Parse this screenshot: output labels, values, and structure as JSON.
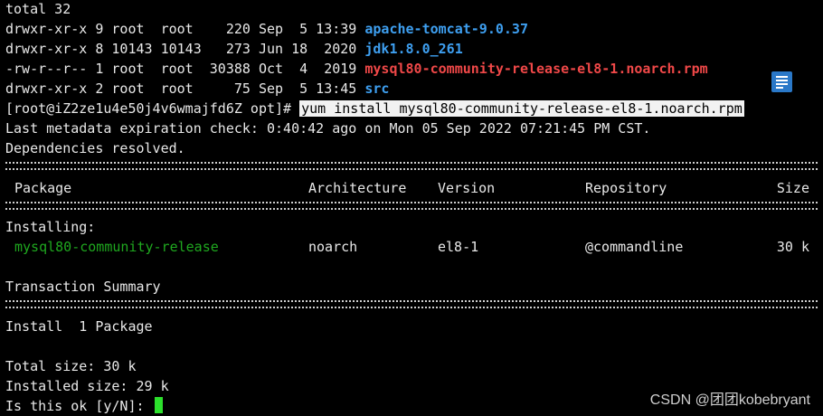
{
  "listing": {
    "total": "total 32",
    "entries": [
      {
        "meta": "drwxr-xr-x 9 root  root    220 Sep  5 13:39 ",
        "name": "apache-tomcat-9.0.37"
      },
      {
        "meta": "drwxr-xr-x 8 10143 10143   273 Jun 18  2020 ",
        "name": "jdk1.8.0_261"
      },
      {
        "meta": "-rw-r--r-- 1 root  root  30388 Oct  4  2019 ",
        "name": "mysql80-community-release-el8-1.noarch.rpm"
      },
      {
        "meta": "drwxr-xr-x 2 root  root     75 Sep  5 13:45 ",
        "name": "src"
      }
    ]
  },
  "prompt": {
    "text": "[root@iZ2ze1u4e50j4v6wmajfd6Z opt]# ",
    "command": "yum install mysql80-community-release-el8-1.noarch.rpm"
  },
  "output": {
    "metadata": "Last metadata expiration check: 0:40:42 ago on Mon 05 Sep 2022 07:21:45 PM CST.",
    "deps": "Dependencies resolved.",
    "headers": {
      "package": "Package",
      "arch": "Architecture",
      "version": "Version",
      "repo": "Repository",
      "size": "Size"
    },
    "installing": "Installing:",
    "pkg": {
      "name": "mysql80-community-release",
      "arch": "noarch",
      "version": "el8-1",
      "repo": "@commandline",
      "size": "30 k"
    },
    "summary": "Transaction Summary",
    "install_count": "Install  1 Package",
    "total_size": "Total size: 30 k",
    "installed_size": "Installed size: 29 k",
    "confirm": "Is this ok [y/N]: "
  },
  "watermark": "CSDN @团团kobebryant",
  "colors": {
    "dir": "#3e9ff0",
    "archive": "#f04848",
    "package": "#1fa81f",
    "cursor": "#2ce02c"
  },
  "icons": {
    "side_icon": "document-icon"
  }
}
